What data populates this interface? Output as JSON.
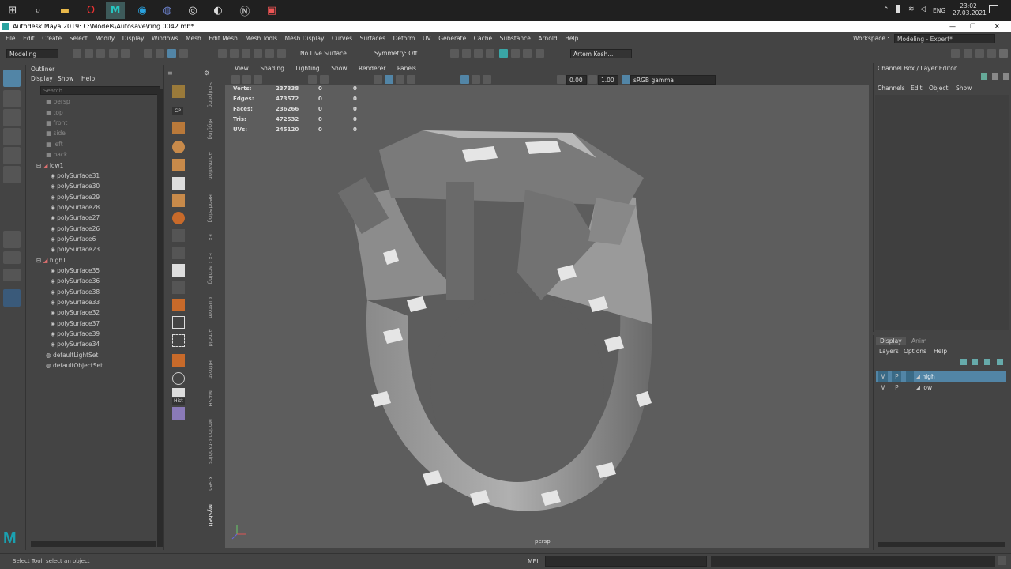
{
  "taskbar": {
    "lang": "ENG",
    "time": "23:02",
    "date": "27.03.2021"
  },
  "window": {
    "title": "Autodesk Maya 2019: C:\\Models\\Autosave\\ring.0042.mb*"
  },
  "menu": [
    "File",
    "Edit",
    "Create",
    "Select",
    "Modify",
    "Display",
    "Windows",
    "Mesh",
    "Edit Mesh",
    "Mesh Tools",
    "Mesh Display",
    "Curves",
    "Surfaces",
    "Deform",
    "UV",
    "Generate",
    "Cache",
    "Substance",
    "Arnold",
    "Help"
  ],
  "workspace": {
    "label": "Workspace :",
    "value": "Modeling - Expert*"
  },
  "shelf": {
    "mode": "Modeling",
    "live_surface": "No Live Surface",
    "symmetry": "Symmetry: Off",
    "user": "Artem Kosh..."
  },
  "outliner": {
    "title": "Outliner",
    "menu": [
      "Display",
      "Show",
      "Help"
    ],
    "search_placeholder": "Search...",
    "cameras": [
      "persp",
      "top",
      "front",
      "side",
      "left",
      "back"
    ],
    "group_low": "low1",
    "low_items": [
      "polySurface31",
      "polySurface30",
      "polySurface29",
      "polySurface28",
      "polySurface27",
      "polySurface26",
      "polySurface6",
      "polySurface23"
    ],
    "group_high": "high1",
    "high_items": [
      "polySurface35",
      "polySurface36",
      "polySurface38",
      "polySurface33",
      "polySurface32",
      "polySurface37",
      "polySurface39",
      "polySurface34"
    ],
    "sets": [
      "defaultLightSet",
      "defaultObjectSet"
    ]
  },
  "shelf_tabs": [
    "Sculpting",
    "Rigging",
    "Animation",
    "Rendering",
    "FX",
    "FX Caching",
    "Custom",
    "Arnold",
    "Bifrost",
    "MASH",
    "Motion Graphics",
    "XGen",
    "MyShelf"
  ],
  "shelf_labels": {
    "cp": "CP",
    "hist": "Hist"
  },
  "viewport": {
    "menu": [
      "View",
      "Shading",
      "Lighting",
      "Show",
      "Renderer",
      "Panels"
    ],
    "exposure": "0.00",
    "gamma": "1.00",
    "colorspace": "sRGB gamma",
    "camera": "persp"
  },
  "hud": [
    {
      "label": "Verts:",
      "v1": "237338",
      "v2": "0",
      "v3": "0"
    },
    {
      "label": "Edges:",
      "v1": "473572",
      "v2": "0",
      "v3": "0"
    },
    {
      "label": "Faces:",
      "v1": "236266",
      "v2": "0",
      "v3": "0"
    },
    {
      "label": "Tris:",
      "v1": "472532",
      "v2": "0",
      "v3": "0"
    },
    {
      "label": "UVs:",
      "v1": "245120",
      "v2": "0",
      "v3": "0"
    }
  ],
  "channelbox": {
    "title": "Channel Box / Layer Editor",
    "menu": [
      "Channels",
      "Edit",
      "Object",
      "Show"
    ]
  },
  "layers": {
    "tabs": [
      "Display",
      "Anim"
    ],
    "menu": [
      "Layers",
      "Options",
      "Help"
    ],
    "items": [
      {
        "v": "V",
        "p": "P",
        "name": "high"
      },
      {
        "v": "V",
        "p": "P",
        "name": "low"
      }
    ]
  },
  "status": {
    "help": "Select Tool: select an object",
    "cmd_label": "MEL"
  }
}
